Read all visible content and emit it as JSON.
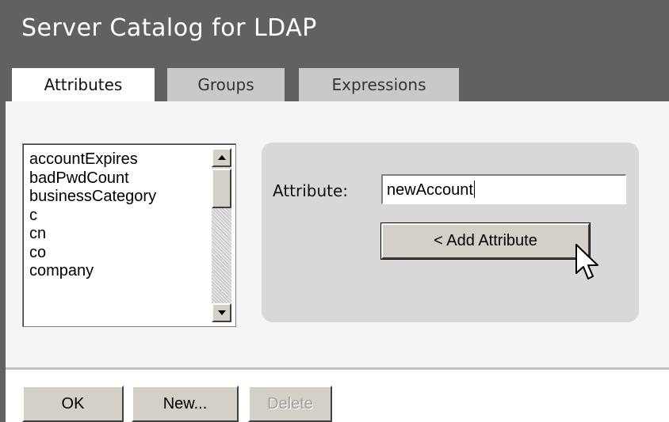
{
  "window": {
    "title": "Server Catalog for LDAP"
  },
  "tabs": [
    {
      "label": "Attributes",
      "active": true
    },
    {
      "label": "Groups",
      "active": false
    },
    {
      "label": "Expressions",
      "active": false
    }
  ],
  "attribute_list": {
    "items": [
      "accountExpires",
      "badPwdCount",
      "businessCategory",
      "c",
      "cn",
      "co",
      "company"
    ]
  },
  "attribute_panel": {
    "label": "Attribute:",
    "input_value": "newAccount",
    "add_button_label": "< Add Attribute"
  },
  "footer": {
    "ok_label": "OK",
    "new_label": "New...",
    "delete_label": "Delete",
    "delete_enabled": false
  },
  "colors": {
    "header_bg": "#616161",
    "content_bg": "#f5f5f5",
    "panel_bg": "#d8d8d8",
    "button_face": "#d4d0c8",
    "inactive_tab": "#c9c9c9"
  },
  "icons": {
    "scroll_up": "arrow-up-icon",
    "scroll_down": "arrow-down-icon",
    "pointer": "mouse-pointer-icon"
  }
}
